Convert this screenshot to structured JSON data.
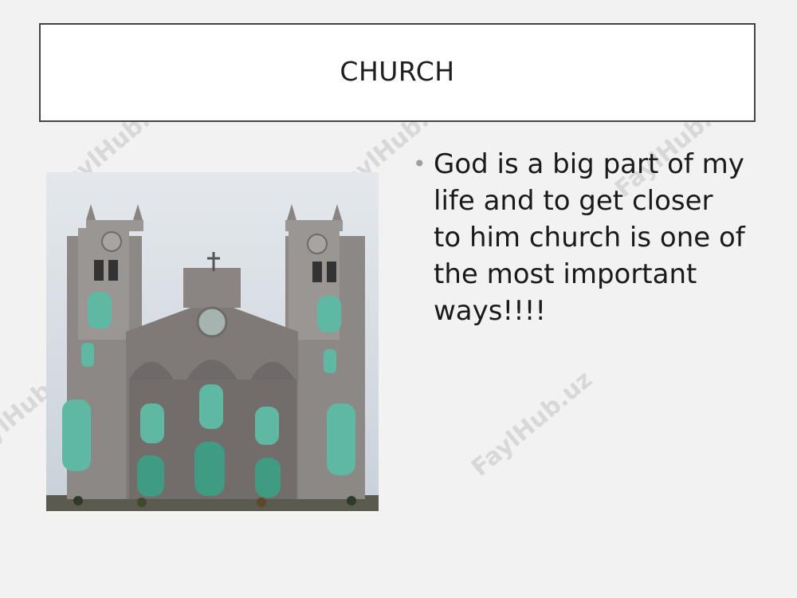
{
  "slide": {
    "title": "CHURCH",
    "bullets": [
      "God is a big part of my life and to get closer to him church is one of the most important ways!!!!"
    ]
  },
  "photo": {
    "icon": "church-photo",
    "colors": {
      "sky": "#d6dde4",
      "stone": "#8a8583",
      "stone_dark": "#6e6a69",
      "window_green": "#5fb9a2",
      "door_green": "#3f9c82"
    }
  },
  "watermark": {
    "text": "FaylHub.uz"
  },
  "theme": {
    "background": "#f2f2f2",
    "title_border": "#444444",
    "bullet_color": "#9aa0a6"
  }
}
